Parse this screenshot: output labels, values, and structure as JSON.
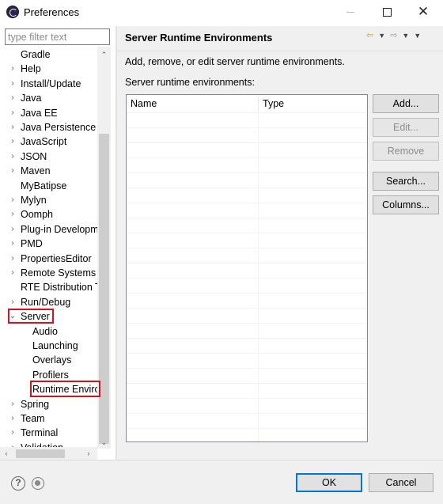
{
  "window": {
    "title": "Preferences"
  },
  "icons": {
    "app": "eclipse-icon",
    "minimize": "minimize-icon",
    "maximize": "maximize-icon",
    "close": "close-icon",
    "back": "back-arrow-icon",
    "forward": "forward-arrow-icon",
    "menu": "view-menu-icon",
    "help": "help-icon",
    "link": "preferences-link-icon"
  },
  "colors": {
    "highlight_box": "#d6121d",
    "default_button": "#0078d7"
  },
  "sidebar": {
    "filter_placeholder": "type filter text",
    "items": [
      {
        "label": "Gradle",
        "twisty": ""
      },
      {
        "label": "Help",
        "twisty": "›"
      },
      {
        "label": "Install/Update",
        "twisty": "›"
      },
      {
        "label": "Java",
        "twisty": "›"
      },
      {
        "label": "Java EE",
        "twisty": "›"
      },
      {
        "label": "Java Persistence",
        "twisty": "›"
      },
      {
        "label": "JavaScript",
        "twisty": "›"
      },
      {
        "label": "JSON",
        "twisty": "›"
      },
      {
        "label": "Maven",
        "twisty": "›"
      },
      {
        "label": "MyBatipse",
        "twisty": ""
      },
      {
        "label": "Mylyn",
        "twisty": "›"
      },
      {
        "label": "Oomph",
        "twisty": "›"
      },
      {
        "label": "Plug-in Developm",
        "twisty": "›"
      },
      {
        "label": "PMD",
        "twisty": "›"
      },
      {
        "label": "PropertiesEditor",
        "twisty": "›"
      },
      {
        "label": "Remote Systems",
        "twisty": "›"
      },
      {
        "label": "RTE Distribution T",
        "twisty": ""
      },
      {
        "label": "Run/Debug",
        "twisty": "›"
      },
      {
        "label": "Server",
        "twisty": "⌄"
      },
      {
        "label": "Audio",
        "twisty": ""
      },
      {
        "label": "Launching",
        "twisty": ""
      },
      {
        "label": "Overlays",
        "twisty": ""
      },
      {
        "label": "Profilers",
        "twisty": ""
      },
      {
        "label": "Runtime Envirc",
        "twisty": ""
      },
      {
        "label": "Spring",
        "twisty": "›"
      },
      {
        "label": "Team",
        "twisty": "›"
      },
      {
        "label": "Terminal",
        "twisty": "›"
      },
      {
        "label": "Validation",
        "twisty": "›"
      }
    ]
  },
  "page": {
    "title": "Server Runtime Environments",
    "description": "Add, remove, or edit server runtime environments.",
    "table_label": "Server runtime environments:",
    "columns": [
      "Name",
      "Type"
    ],
    "buttons": [
      "Add...",
      "Edit...",
      "Remove",
      "Search...",
      "Columns..."
    ]
  },
  "footer": {
    "ok": "OK",
    "cancel": "Cancel"
  }
}
